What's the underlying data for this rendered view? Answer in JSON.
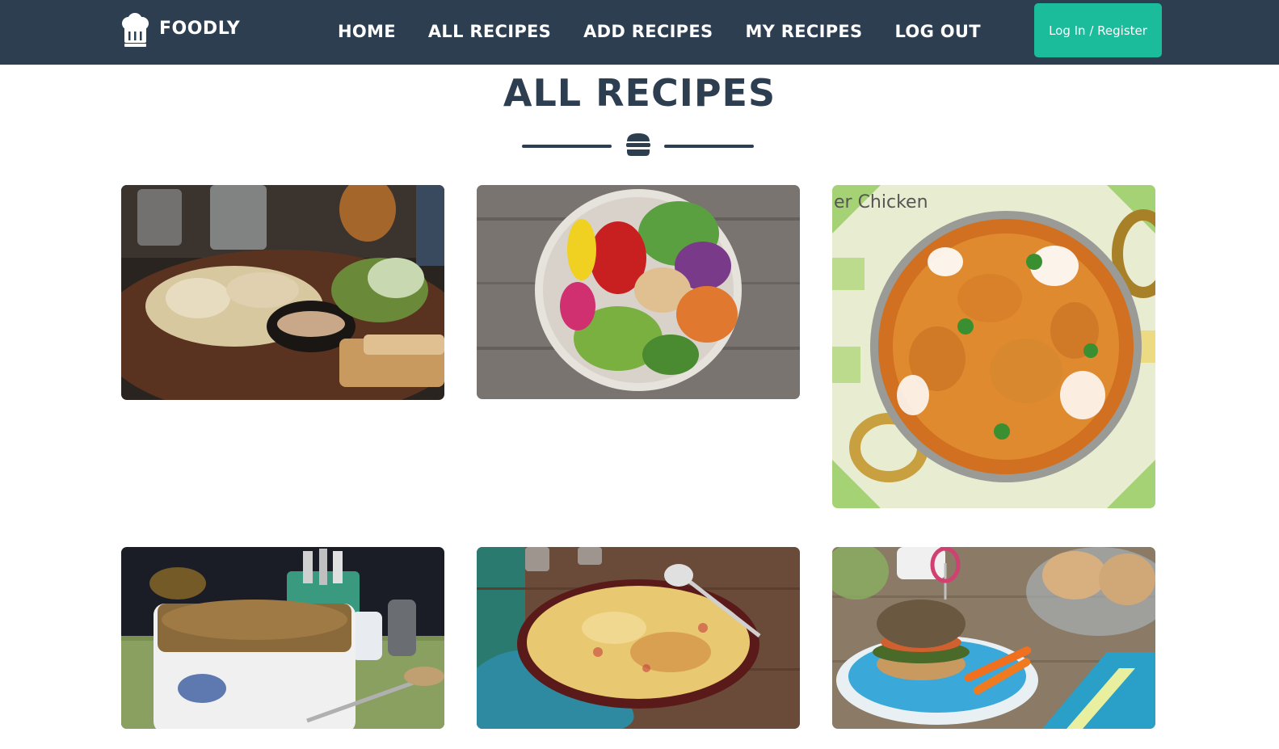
{
  "brand": {
    "name": "FOODLY",
    "icon": "chef-hat-icon"
  },
  "nav": {
    "links": [
      "HOME",
      "ALL RECIPES",
      "ADD RECIPES",
      "MY RECIPES",
      "LOG OUT"
    ],
    "login_label": "Log In / Register"
  },
  "page": {
    "title": "ALL RECIPES",
    "divider_icon": "burger-icon"
  },
  "recipes": [
    {
      "image": "grilled-fish-plate-photo"
    },
    {
      "image": "veggie-bowl-photo"
    },
    {
      "image": "butter-chicken-curry-photo",
      "caption": "er Chicken"
    },
    {
      "image": "casserole-dish-photo"
    },
    {
      "image": "mac-and-cheese-bake-photo"
    },
    {
      "image": "veggie-burger-photo"
    }
  ],
  "colors": {
    "navbar": "#2c3e50",
    "accent": "#1abc9c",
    "title": "#2c3e50"
  }
}
